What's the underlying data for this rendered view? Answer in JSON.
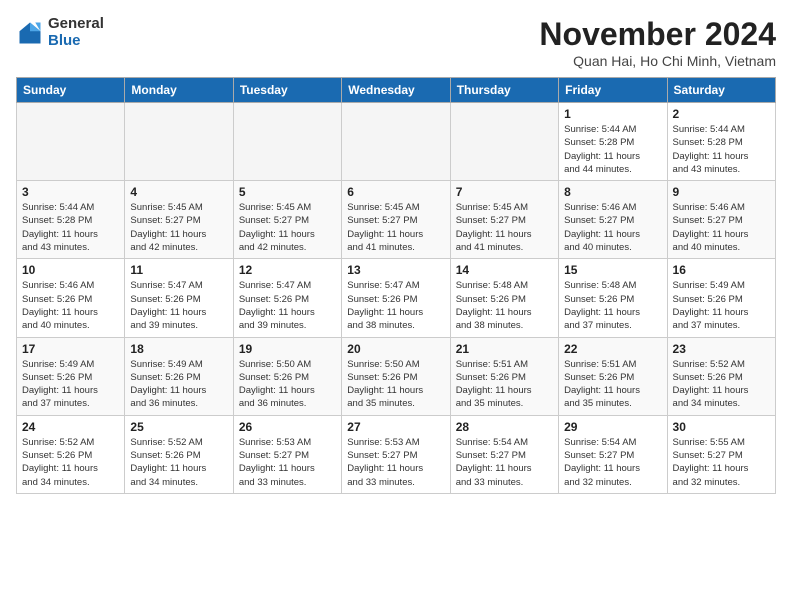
{
  "logo": {
    "general": "General",
    "blue": "Blue"
  },
  "title": "November 2024",
  "location": "Quan Hai, Ho Chi Minh, Vietnam",
  "days_of_week": [
    "Sunday",
    "Monday",
    "Tuesday",
    "Wednesday",
    "Thursday",
    "Friday",
    "Saturday"
  ],
  "weeks": [
    [
      {
        "day": "",
        "detail": ""
      },
      {
        "day": "",
        "detail": ""
      },
      {
        "day": "",
        "detail": ""
      },
      {
        "day": "",
        "detail": ""
      },
      {
        "day": "",
        "detail": ""
      },
      {
        "day": "1",
        "detail": "Sunrise: 5:44 AM\nSunset: 5:28 PM\nDaylight: 11 hours\nand 44 minutes."
      },
      {
        "day": "2",
        "detail": "Sunrise: 5:44 AM\nSunset: 5:28 PM\nDaylight: 11 hours\nand 43 minutes."
      }
    ],
    [
      {
        "day": "3",
        "detail": "Sunrise: 5:44 AM\nSunset: 5:28 PM\nDaylight: 11 hours\nand 43 minutes."
      },
      {
        "day": "4",
        "detail": "Sunrise: 5:45 AM\nSunset: 5:27 PM\nDaylight: 11 hours\nand 42 minutes."
      },
      {
        "day": "5",
        "detail": "Sunrise: 5:45 AM\nSunset: 5:27 PM\nDaylight: 11 hours\nand 42 minutes."
      },
      {
        "day": "6",
        "detail": "Sunrise: 5:45 AM\nSunset: 5:27 PM\nDaylight: 11 hours\nand 41 minutes."
      },
      {
        "day": "7",
        "detail": "Sunrise: 5:45 AM\nSunset: 5:27 PM\nDaylight: 11 hours\nand 41 minutes."
      },
      {
        "day": "8",
        "detail": "Sunrise: 5:46 AM\nSunset: 5:27 PM\nDaylight: 11 hours\nand 40 minutes."
      },
      {
        "day": "9",
        "detail": "Sunrise: 5:46 AM\nSunset: 5:27 PM\nDaylight: 11 hours\nand 40 minutes."
      }
    ],
    [
      {
        "day": "10",
        "detail": "Sunrise: 5:46 AM\nSunset: 5:26 PM\nDaylight: 11 hours\nand 40 minutes."
      },
      {
        "day": "11",
        "detail": "Sunrise: 5:47 AM\nSunset: 5:26 PM\nDaylight: 11 hours\nand 39 minutes."
      },
      {
        "day": "12",
        "detail": "Sunrise: 5:47 AM\nSunset: 5:26 PM\nDaylight: 11 hours\nand 39 minutes."
      },
      {
        "day": "13",
        "detail": "Sunrise: 5:47 AM\nSunset: 5:26 PM\nDaylight: 11 hours\nand 38 minutes."
      },
      {
        "day": "14",
        "detail": "Sunrise: 5:48 AM\nSunset: 5:26 PM\nDaylight: 11 hours\nand 38 minutes."
      },
      {
        "day": "15",
        "detail": "Sunrise: 5:48 AM\nSunset: 5:26 PM\nDaylight: 11 hours\nand 37 minutes."
      },
      {
        "day": "16",
        "detail": "Sunrise: 5:49 AM\nSunset: 5:26 PM\nDaylight: 11 hours\nand 37 minutes."
      }
    ],
    [
      {
        "day": "17",
        "detail": "Sunrise: 5:49 AM\nSunset: 5:26 PM\nDaylight: 11 hours\nand 37 minutes."
      },
      {
        "day": "18",
        "detail": "Sunrise: 5:49 AM\nSunset: 5:26 PM\nDaylight: 11 hours\nand 36 minutes."
      },
      {
        "day": "19",
        "detail": "Sunrise: 5:50 AM\nSunset: 5:26 PM\nDaylight: 11 hours\nand 36 minutes."
      },
      {
        "day": "20",
        "detail": "Sunrise: 5:50 AM\nSunset: 5:26 PM\nDaylight: 11 hours\nand 35 minutes."
      },
      {
        "day": "21",
        "detail": "Sunrise: 5:51 AM\nSunset: 5:26 PM\nDaylight: 11 hours\nand 35 minutes."
      },
      {
        "day": "22",
        "detail": "Sunrise: 5:51 AM\nSunset: 5:26 PM\nDaylight: 11 hours\nand 35 minutes."
      },
      {
        "day": "23",
        "detail": "Sunrise: 5:52 AM\nSunset: 5:26 PM\nDaylight: 11 hours\nand 34 minutes."
      }
    ],
    [
      {
        "day": "24",
        "detail": "Sunrise: 5:52 AM\nSunset: 5:26 PM\nDaylight: 11 hours\nand 34 minutes."
      },
      {
        "day": "25",
        "detail": "Sunrise: 5:52 AM\nSunset: 5:26 PM\nDaylight: 11 hours\nand 34 minutes."
      },
      {
        "day": "26",
        "detail": "Sunrise: 5:53 AM\nSunset: 5:27 PM\nDaylight: 11 hours\nand 33 minutes."
      },
      {
        "day": "27",
        "detail": "Sunrise: 5:53 AM\nSunset: 5:27 PM\nDaylight: 11 hours\nand 33 minutes."
      },
      {
        "day": "28",
        "detail": "Sunrise: 5:54 AM\nSunset: 5:27 PM\nDaylight: 11 hours\nand 33 minutes."
      },
      {
        "day": "29",
        "detail": "Sunrise: 5:54 AM\nSunset: 5:27 PM\nDaylight: 11 hours\nand 32 minutes."
      },
      {
        "day": "30",
        "detail": "Sunrise: 5:55 AM\nSunset: 5:27 PM\nDaylight: 11 hours\nand 32 minutes."
      }
    ]
  ]
}
